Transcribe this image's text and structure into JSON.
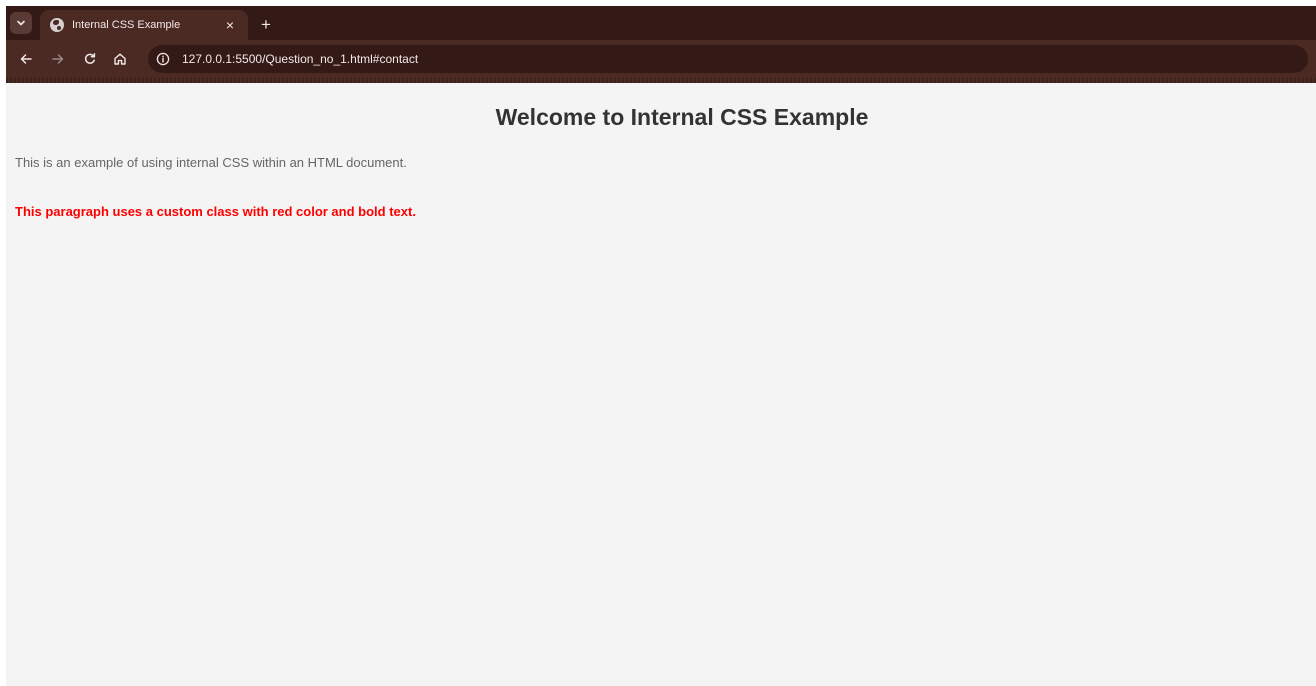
{
  "browser": {
    "tab": {
      "title": "Internal CSS Example",
      "close_symbol": "×"
    },
    "new_tab_symbol": "+",
    "icons": {
      "tab_search": "chevron-down-icon",
      "favicon": "globe-icon",
      "back": "arrow-left-icon",
      "forward": "arrow-right-icon",
      "reload": "reload-icon",
      "home": "home-icon",
      "site_info": "info-icon"
    },
    "url": "127.0.0.1:5500/Question_no_1.html#contact"
  },
  "page": {
    "heading": "Welcome to Internal CSS Example",
    "intro": "This is an example of using internal CSS within an HTML document.",
    "custom": "This paragraph uses a custom class with red color and bold text."
  },
  "colors": {
    "chrome_dark": "#341a16",
    "chrome_toolbar": "#4b2a24",
    "page_background": "#f4f4f4",
    "heading_text": "#333333",
    "body_text": "#666666",
    "custom_text": "#ff0000"
  }
}
